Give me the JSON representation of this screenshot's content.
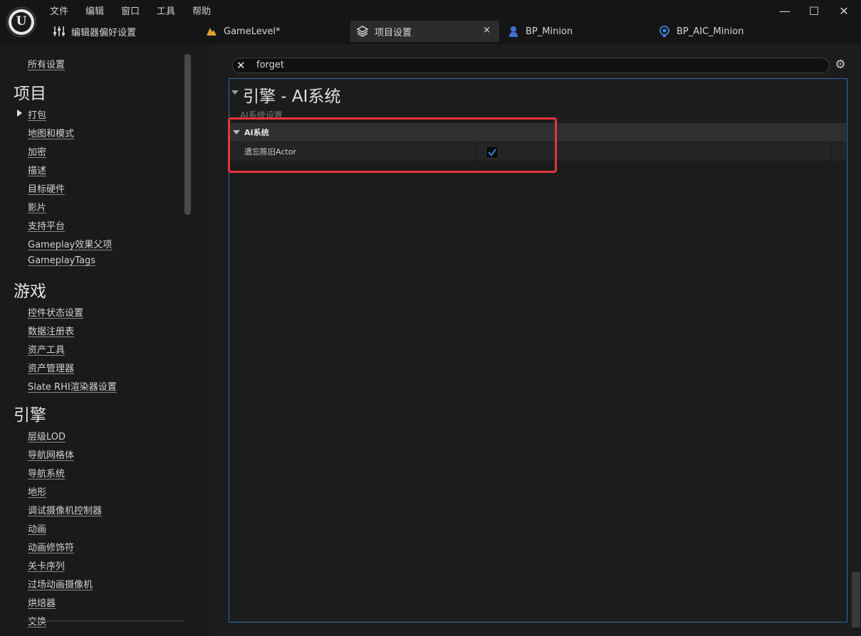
{
  "menu": [
    "文件",
    "编辑",
    "窗口",
    "工具",
    "帮助"
  ],
  "window_controls": {
    "minimize": "—",
    "maximize": "☐",
    "close": "✕"
  },
  "tabs": [
    {
      "label": "编辑器偏好设置",
      "icon": "sliders-icon"
    },
    {
      "label": "GameLevel*",
      "icon": "level-icon"
    },
    {
      "label": "项目设置",
      "icon": "project-settings-icon",
      "active": true,
      "close": "×"
    },
    {
      "label": "BP_Minion",
      "icon": "character-blueprint-icon"
    },
    {
      "label": "BP_AIC_Minion",
      "icon": "ai-controller-icon"
    }
  ],
  "sidebar": {
    "all_settings": "所有设置",
    "categories": [
      {
        "title": "项目",
        "items": [
          "打包",
          "地图和模式",
          "加密",
          "描述",
          "目标硬件",
          "影片",
          "支持平台",
          "Gameplay效果父项",
          "GameplayTags"
        ]
      },
      {
        "title": "游戏",
        "items": [
          "控件状态设置",
          "数据注册表",
          "资产工具",
          "资产管理器",
          "Slate RHI渲染器设置"
        ]
      },
      {
        "title": "引擎",
        "items": [
          "层级LOD",
          "导航网格体",
          "导航系统",
          "地形",
          "调试摄像机控制器",
          "动画",
          "动画修饰符",
          "关卡序列",
          "过场动画摄像机",
          "烘焙器",
          "交换"
        ]
      }
    ]
  },
  "search": {
    "value": "forget",
    "clear": "✕"
  },
  "settings_icon": "⚙",
  "section": {
    "title": "引擎 - AI系统",
    "subtitle": "AI系统设置",
    "category": "AI系统",
    "property": {
      "label": "遗忘陈旧Actor",
      "checked": true
    }
  },
  "colors": {
    "accent": "#2d6fb0",
    "highlight": "#e8333a",
    "check": "#2f7fd6"
  }
}
